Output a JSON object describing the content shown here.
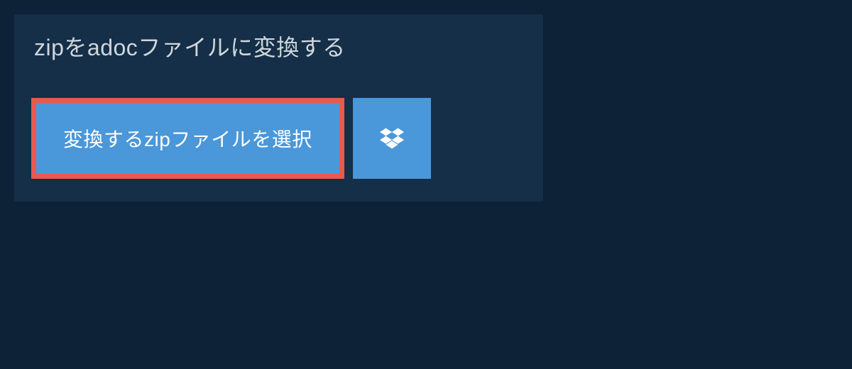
{
  "header": {
    "title": "zipをadocファイルに変換する"
  },
  "actions": {
    "select_file_label": "変換するzipファイルを選択",
    "dropbox_label": "Dropbox"
  },
  "colors": {
    "background": "#0d2137",
    "panel": "#142f47",
    "button": "#4a97d9",
    "highlight_border": "#e85a4f",
    "text_light": "#d0d6dc"
  }
}
